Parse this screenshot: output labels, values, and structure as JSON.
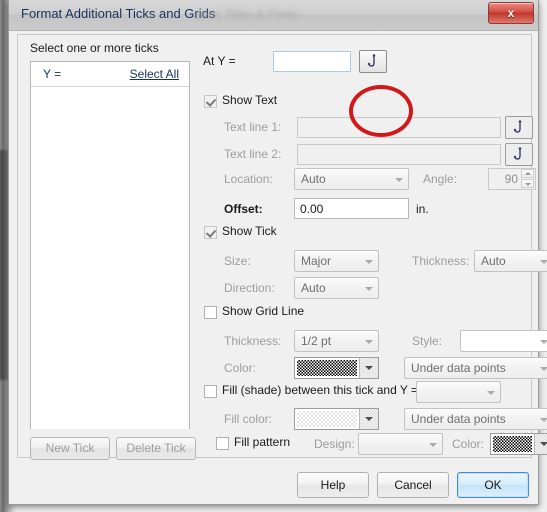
{
  "window": {
    "title": "Format Additional Ticks and Grids",
    "blurred_title_suffix": "axes    Titles & Fonts",
    "close_label": "x"
  },
  "left_panel": {
    "heading": "Select one or more ticks",
    "list_header_left": "Y =",
    "select_all_label": "Select All",
    "new_tick_label": "New Tick",
    "delete_tick_label": "Delete Tick"
  },
  "at_y": {
    "label": "At Y =",
    "value": "",
    "picker_icon": "hook-icon"
  },
  "show_text": {
    "checkbox_label": "Show Text",
    "checked": true,
    "text_line_1_label": "Text line 1:",
    "text_line_1_value": "",
    "text_line_2_label": "Text line 2:",
    "text_line_2_value": "",
    "location_label": "Location:",
    "location_value": "Auto",
    "angle_label": "Angle:",
    "angle_value": "90",
    "offset_label": "Offset:",
    "offset_value": "0.00",
    "offset_units": "in."
  },
  "show_tick": {
    "checkbox_label": "Show Tick",
    "checked": true,
    "size_label": "Size:",
    "size_value": "Major",
    "thickness_label": "Thickness:",
    "thickness_value": "Auto",
    "direction_label": "Direction:",
    "direction_value": "Auto"
  },
  "show_grid_line": {
    "checkbox_label": "Show Grid Line",
    "checked": false,
    "thickness_label": "Thickness:",
    "thickness_value": "1/2 pt",
    "style_label": "Style:",
    "style_value": "",
    "color_label": "Color:",
    "color_swatch": "black-dither",
    "layer_value": "Under data points"
  },
  "fill_section": {
    "checkbox_label": "Fill (shade) between this tick and Y =",
    "checked": false,
    "target_value": "",
    "fill_color_label": "Fill color:",
    "fill_color_swatch": "white-dither",
    "layer_value": "Under data points",
    "fill_pattern_label": "Fill pattern",
    "fill_pattern_checked": false,
    "design_label": "Design:",
    "design_value": "",
    "pattern_color_label": "Color:",
    "pattern_color_swatch": "black-dither"
  },
  "footer": {
    "help_label": "Help",
    "cancel_label": "Cancel",
    "ok_label": "OK"
  },
  "annotation": {
    "highlight_color": "#d01919",
    "target": "at-y-picker-button"
  }
}
